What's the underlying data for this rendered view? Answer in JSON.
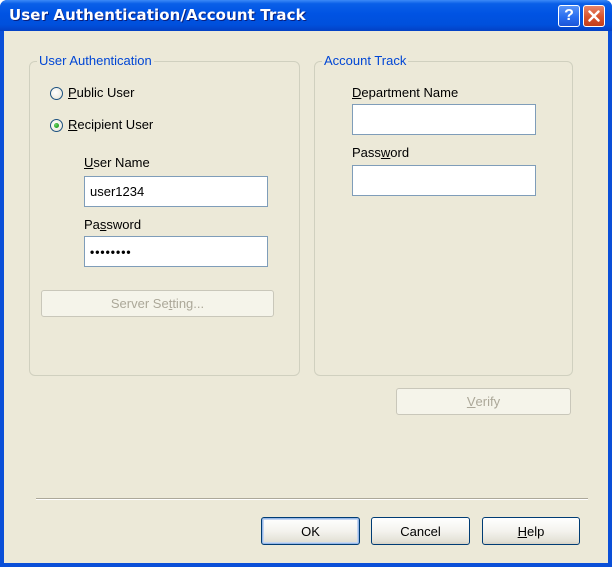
{
  "window": {
    "title": "User Authentication/Account Track",
    "help_glyph": "?",
    "close_glyph": "✕"
  },
  "user_auth": {
    "legend": "User Authentication",
    "public_user": {
      "prefix": "",
      "accel": "P",
      "suffix": "ublic User",
      "selected": false
    },
    "recipient_user": {
      "prefix": "",
      "accel": "R",
      "suffix": "ecipient User",
      "selected": true
    },
    "username_label": {
      "prefix": "",
      "accel": "U",
      "suffix": "ser Name"
    },
    "username_value": "user1234",
    "password_label": {
      "prefix": "Pa",
      "accel": "s",
      "suffix": "sword"
    },
    "password_value": "••••••••",
    "server_setting": {
      "prefix": "Server Se",
      "accel": "t",
      "suffix": "ting..."
    }
  },
  "account_track": {
    "legend": "Account Track",
    "department_label": {
      "prefix": "",
      "accel": "D",
      "suffix": "epartment Name"
    },
    "department_value": "",
    "password_label": {
      "prefix": "Pass",
      "accel": "w",
      "suffix": "ord"
    },
    "password_value": "",
    "verify": {
      "prefix": "",
      "accel": "V",
      "suffix": "erify"
    }
  },
  "footer": {
    "ok": "OK",
    "cancel": "Cancel",
    "help": {
      "prefix": "",
      "accel": "H",
      "suffix": "elp"
    }
  },
  "colors": {
    "titlebar": "#0053e3",
    "dialog_bg": "#ece9d8",
    "groupbox_title": "#0046d5",
    "disabled_text": "#aca899"
  }
}
